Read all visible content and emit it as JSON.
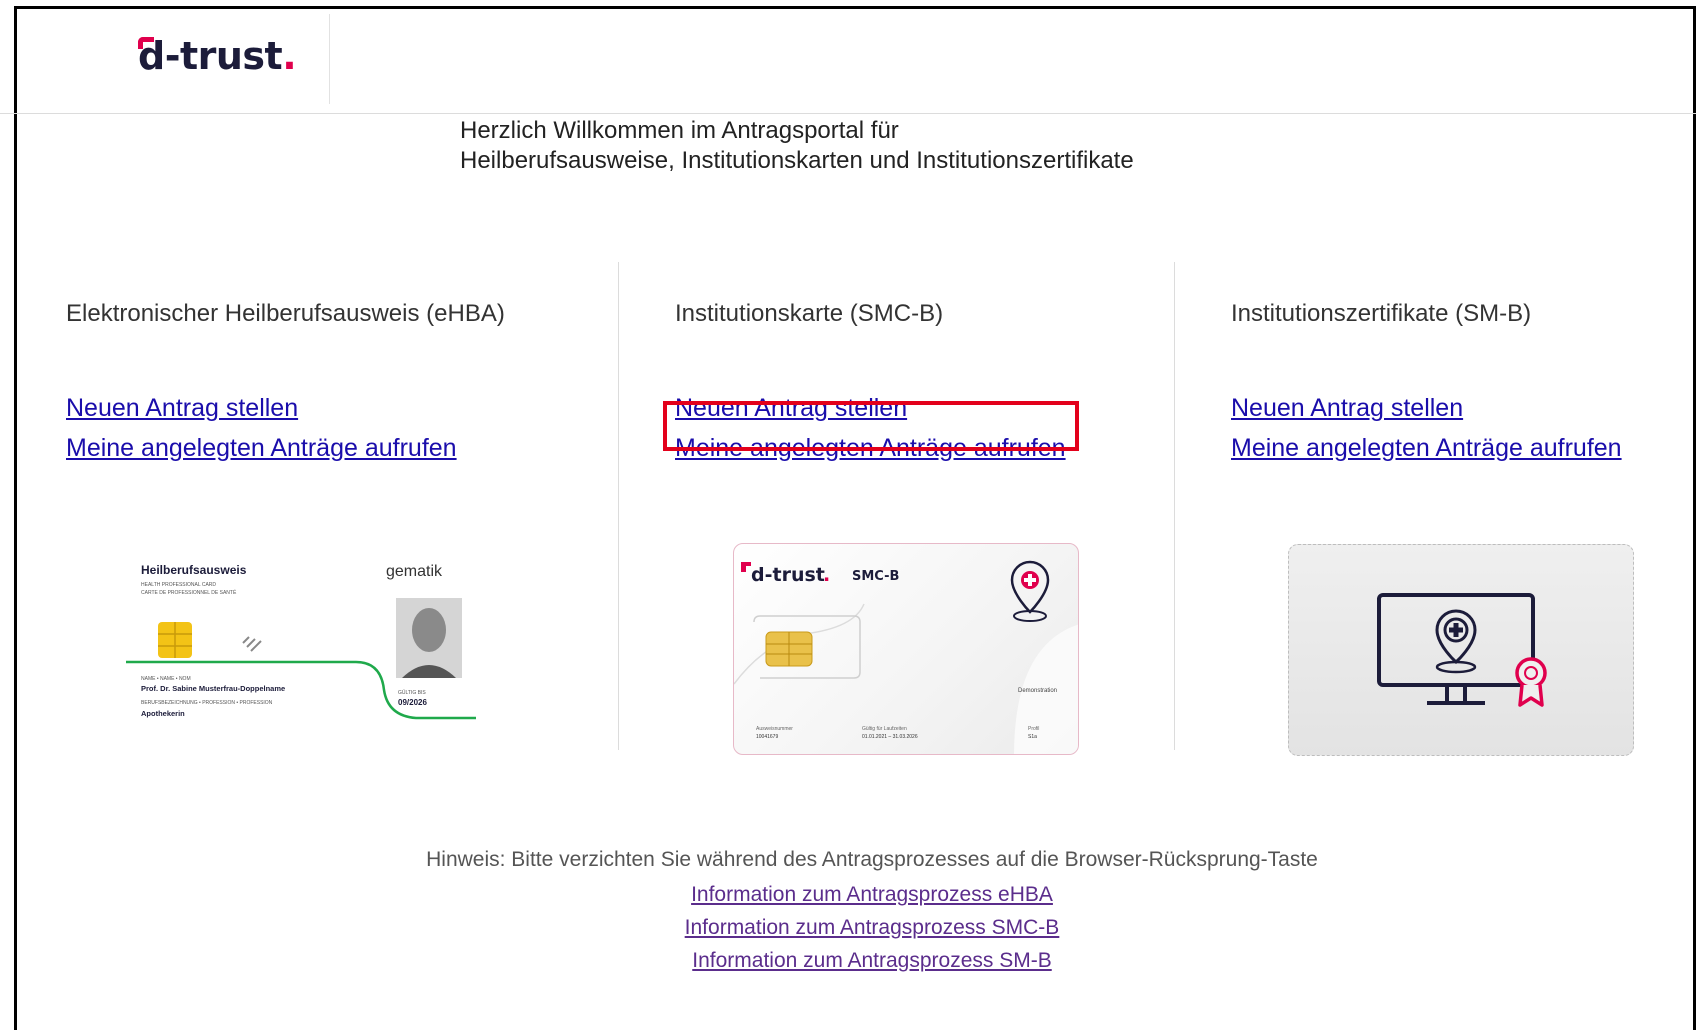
{
  "brand": {
    "logo_text": "d-trust",
    "logo_dot": ".",
    "accent": "#e0004d",
    "navy": "#1c1c3a"
  },
  "welcome": {
    "line1": "Herzlich Willkommen im Antragsportal für",
    "line2": "Heilberufsausweise, Institutionskarten und Institutionszertifikate"
  },
  "columns": [
    {
      "title": "Elektronischer Heilberufsausweis (eHBA)",
      "new_request": "Neuen Antrag stellen",
      "my_requests": "Meine angelegten Anträge aufrufen"
    },
    {
      "title": "Institutionskarte (SMC-B)",
      "new_request": "Neuen Antrag stellen",
      "my_requests": "Meine angelegten Anträge aufrufen"
    },
    {
      "title": "Institutionszertifikate (SM-B)",
      "new_request": "Neuen Antrag stellen",
      "my_requests": "Meine angelegten Anträge aufrufen"
    }
  ],
  "ehba_card": {
    "title": "Heilberufsausweis",
    "sub1": "HEALTH PROFESSIONAL CARD",
    "sub2": "CARTE DE PROFESSIONNEL DE SANTÉ",
    "issuer": "gematik",
    "name_label": "NAME • NAME • NOM",
    "name": "Prof. Dr. Sabine Musterfrau-Doppelname",
    "profession_label": "BERUFSBEZEICHNUNG • PROFESSION • PROFESSION",
    "profession": "Apothekerin",
    "valid_label": "GÜLTIG BIS",
    "valid": "09/2026"
  },
  "smcb_card": {
    "logo": "d-trust",
    "type": "SMC-B",
    "role": "Demonstration",
    "field1_label": "Ausweisnummer",
    "field1_value": "10041679",
    "field2_label": "Gültig für Laufzeiten",
    "field2_value": "01.01.2021 – 31.03.2026",
    "field3_label": "Profil",
    "field3_value": "S1a"
  },
  "footer": {
    "hint": "Hinweis: Bitte verzichten Sie während des Antragsprozesses auf die Browser-Rücksprung-Taste",
    "links": [
      "Information zum Antragsprozess eHBA",
      "Information zum Antragsprozess SMC-B",
      "Information zum Antragsprozess SM-B"
    ]
  },
  "colors": {
    "link": "#1a0dab",
    "visited_link": "#5b2d8c",
    "highlight": "#e3001b"
  }
}
